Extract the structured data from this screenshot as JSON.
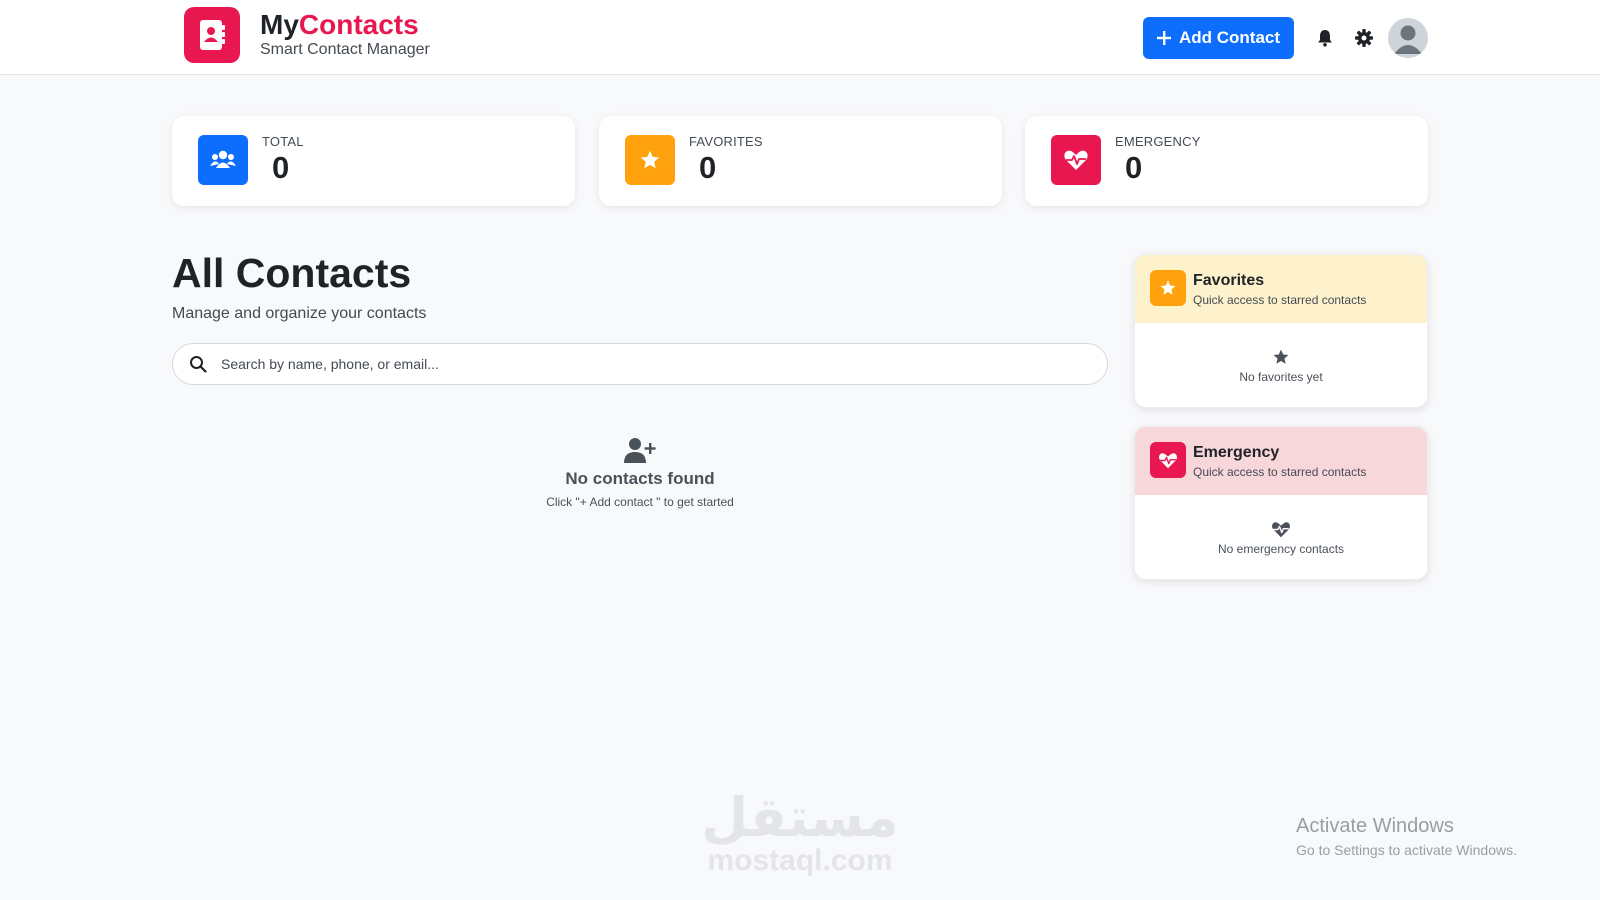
{
  "header": {
    "brand_prefix": "My",
    "brand_accent": "Contacts",
    "brand_subtitle": "Smart Contact Manager",
    "add_button_label": "Add Contact",
    "icons": [
      "address-book-icon",
      "plus-icon",
      "bell-icon",
      "gear-icon",
      "user-avatar-icon"
    ]
  },
  "stats": [
    {
      "label": "TOTAL",
      "value": "0",
      "icon": "users-icon",
      "color": "#0d6efd"
    },
    {
      "label": "FAVORITES",
      "value": "0",
      "icon": "star-icon",
      "color": "#ffa20d"
    },
    {
      "label": "EMERGENCY",
      "value": "0",
      "icon": "heart-pulse-icon",
      "color": "#e8174f"
    }
  ],
  "main": {
    "title": "All Contacts",
    "subtitle": "Manage and organize your contacts",
    "search_placeholder": "Search by name, phone, or email...",
    "empty_title": "No contacts found",
    "empty_hint": "Click \"+ Add contact \" to get started"
  },
  "panels": {
    "favorites": {
      "title": "Favorites",
      "subtitle": "Quick access to starred contacts",
      "empty_text": "No favorites yet",
      "header_bg": "#fdf2cc",
      "icon_color": "#ffa20d"
    },
    "emergency": {
      "title": "Emergency",
      "subtitle": "Quick access to starred contacts",
      "empty_text": "No emergency contacts",
      "header_bg": "#f8d7db",
      "icon_color": "#e8174f"
    }
  },
  "watermarks": {
    "logo_arabic": "مستقل",
    "logo_latin": "mostaql.com",
    "activate_title": "Activate Windows",
    "activate_hint": "Go to Settings to activate Windows."
  },
  "colors": {
    "accent": "#e8174f",
    "primary": "#0d6efd",
    "background": "#f8f9fb"
  }
}
